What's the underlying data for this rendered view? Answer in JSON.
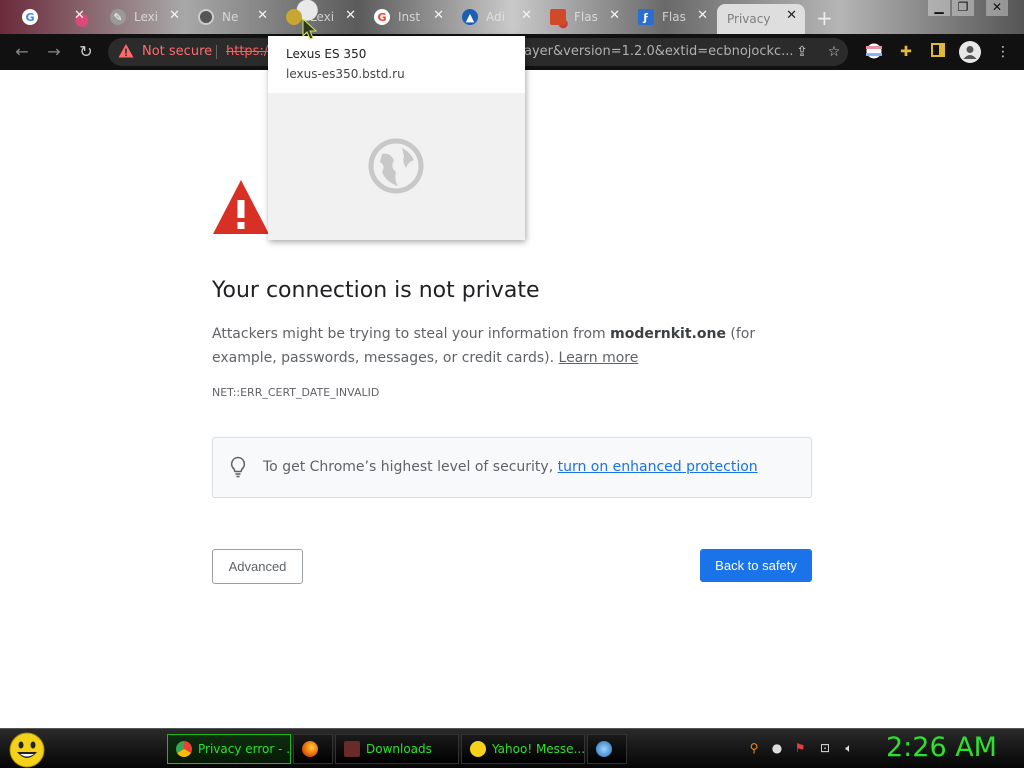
{
  "browser": {
    "tabs": [
      {
        "label": "",
        "icon": "google-icon"
      },
      {
        "label": "Lexi",
        "icon": "pencil-icon"
      },
      {
        "label": "Ne",
        "icon": "chrome-icon"
      },
      {
        "label": "Lexi",
        "icon": "globe-icon"
      },
      {
        "label": "Inst",
        "icon": "google-icon"
      },
      {
        "label": "Adi",
        "icon": "drive-icon"
      },
      {
        "label": "Flas",
        "icon": "cube-icon"
      },
      {
        "label": "Flas",
        "icon": "flash-icon"
      },
      {
        "label": "Privacy e",
        "icon": "none",
        "active": true
      }
    ],
    "new_tab": "+",
    "address": {
      "security_label": "Not secure",
      "scheme": "https:/",
      "url_rest": "ayer&version=1.2.0&extid=ecbnojockc..."
    }
  },
  "hover_card": {
    "title": "Lexus ES 350",
    "url": "lexus-es350.bstd.ru"
  },
  "interstitial": {
    "headline": "Your connection is not private",
    "body_pre": "Attackers might be trying to steal your information from ",
    "domain": "modernkit.one",
    "body_post": " (for example, passwords, messages, or credit cards). ",
    "learn_more": "Learn more",
    "error_code": "NET::ERR_CERT_DATE_INVALID",
    "tip_text": "To get Chrome’s highest level of security, ",
    "tip_link": "turn on enhanced protection",
    "advanced_label": "Advanced",
    "back_label": "Back to safety",
    "colors": {
      "accent": "#1a73e8",
      "danger": "#d93025"
    }
  },
  "taskbar": {
    "items": [
      {
        "label": "Privacy error - ...",
        "icon": "chrome-icon",
        "active": true
      },
      {
        "label": "",
        "icon": "firefox-icon"
      },
      {
        "label": "Downloads",
        "icon": "folder-icon"
      },
      {
        "label": "Yahoo! Messe...",
        "icon": "smiley-icon"
      },
      {
        "label": "",
        "icon": "globe-icon"
      }
    ],
    "clock": "2:26 AM"
  }
}
